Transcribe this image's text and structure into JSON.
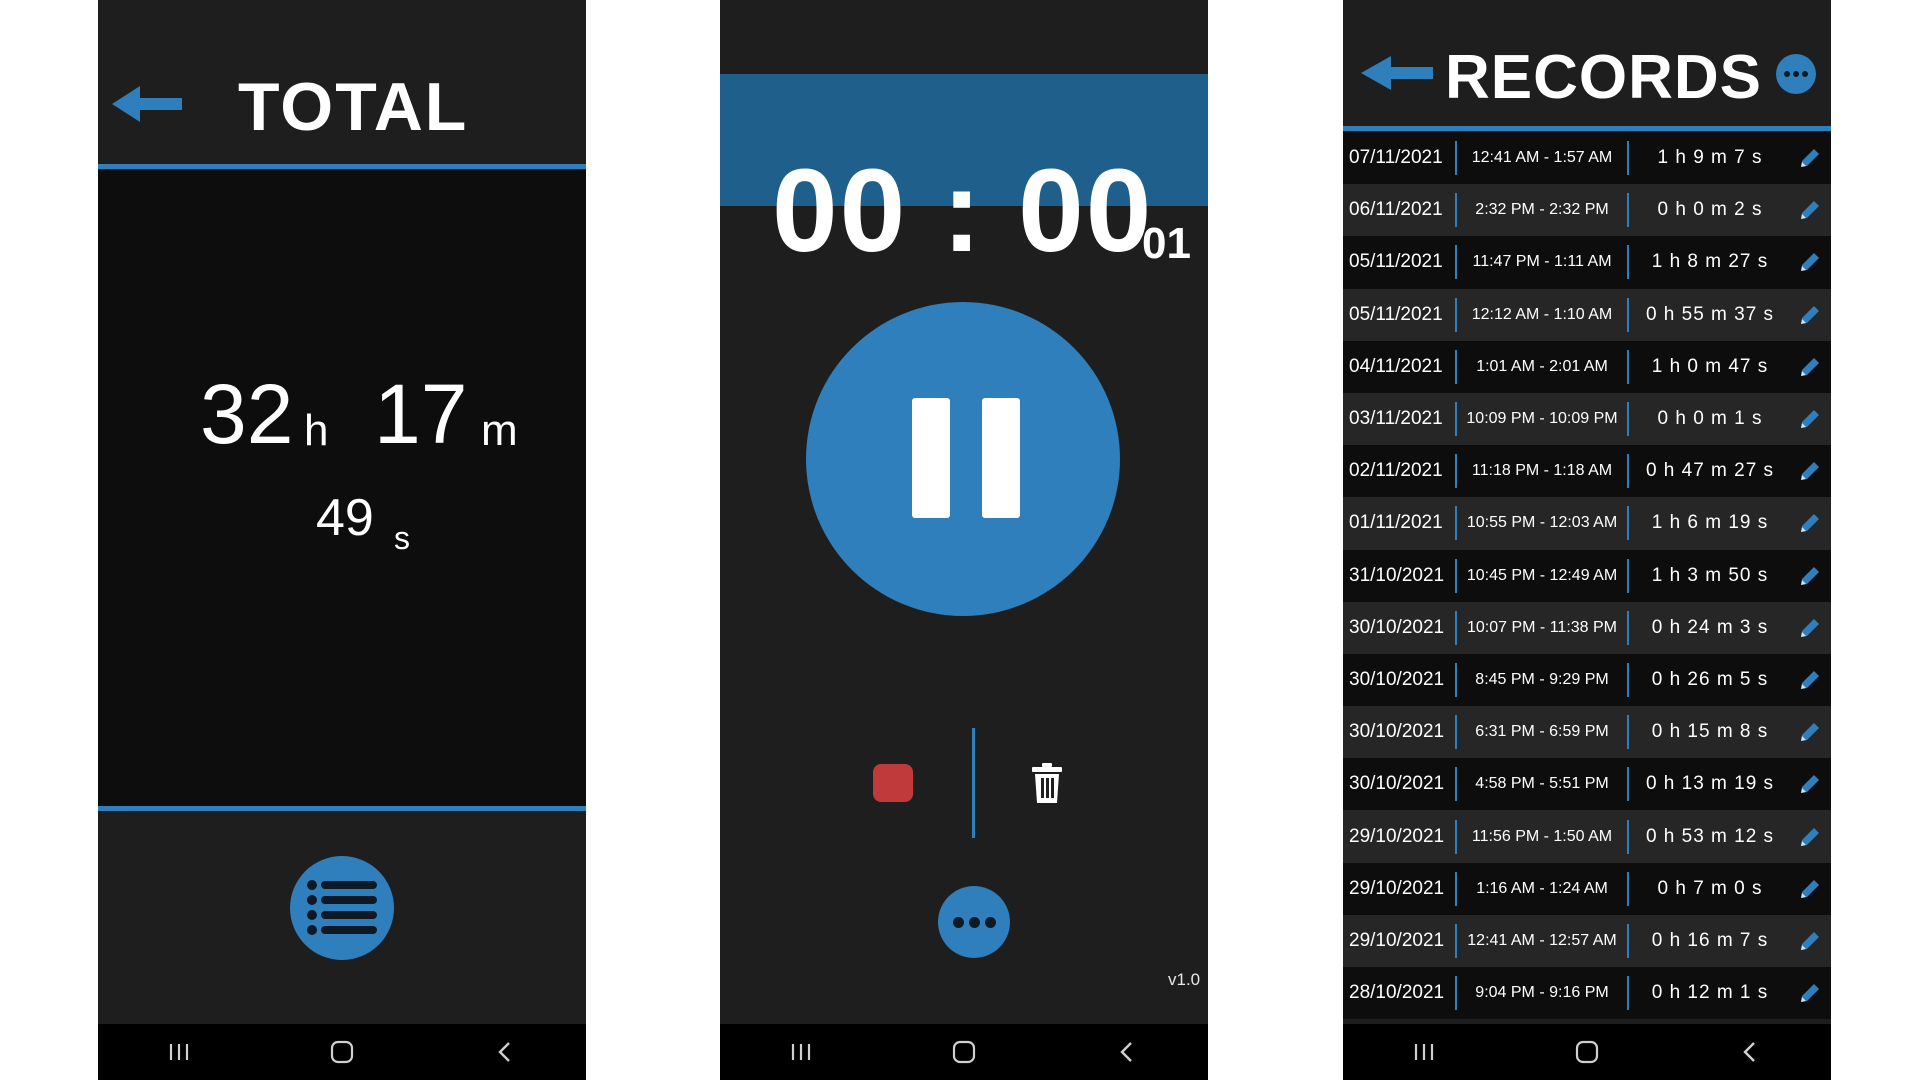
{
  "total_screen": {
    "title": "TOTAL",
    "hours": "32",
    "hours_unit": "h",
    "minutes": "17",
    "minutes_unit": "m",
    "seconds": "49",
    "seconds_unit": "s",
    "icons": {
      "back": "back-arrow-icon",
      "list": "list-icon"
    }
  },
  "timer_screen": {
    "time": "00 : 00",
    "fraction": "01",
    "version": "v1.0",
    "icons": {
      "pause": "pause-icon",
      "stop": "stop-icon",
      "delete": "trash-icon",
      "more": "more-icon"
    }
  },
  "records_screen": {
    "title": "RECORDS",
    "icons": {
      "back": "back-arrow-icon",
      "more": "more-icon",
      "edit": "pencil-icon"
    },
    "records": [
      {
        "date": "07/11/2021",
        "time": "12:41 AM - 1:57 AM",
        "duration": "1 h 9 m 7 s"
      },
      {
        "date": "06/11/2021",
        "time": "2:32 PM - 2:32 PM",
        "duration": "0 h 0 m 2 s"
      },
      {
        "date": "05/11/2021",
        "time": "11:47 PM - 1:11 AM",
        "duration": "1 h 8 m 27 s"
      },
      {
        "date": "05/11/2021",
        "time": "12:12 AM - 1:10 AM",
        "duration": "0 h 55 m 37 s"
      },
      {
        "date": "04/11/2021",
        "time": "1:01 AM - 2:01 AM",
        "duration": "1 h 0 m 47 s"
      },
      {
        "date": "03/11/2021",
        "time": "10:09 PM - 10:09 PM",
        "duration": "0 h 0 m 1 s"
      },
      {
        "date": "02/11/2021",
        "time": "11:18 PM - 1:18 AM",
        "duration": "0 h 47 m 27 s"
      },
      {
        "date": "01/11/2021",
        "time": "10:55 PM - 12:03 AM",
        "duration": "1 h 6 m 19 s"
      },
      {
        "date": "31/10/2021",
        "time": "10:45 PM - 12:49 AM",
        "duration": "1 h 3 m 50 s"
      },
      {
        "date": "30/10/2021",
        "time": "10:07 PM - 11:38 PM",
        "duration": "0 h 24 m 3 s"
      },
      {
        "date": "30/10/2021",
        "time": "8:45 PM - 9:29 PM",
        "duration": "0 h 26 m 5 s"
      },
      {
        "date": "30/10/2021",
        "time": "6:31 PM - 6:59 PM",
        "duration": "0 h 15 m 8 s"
      },
      {
        "date": "30/10/2021",
        "time": "4:58 PM - 5:51 PM",
        "duration": "0 h 13 m 19 s"
      },
      {
        "date": "29/10/2021",
        "time": "11:56 PM - 1:50 AM",
        "duration": "0 h 53 m 12 s"
      },
      {
        "date": "29/10/2021",
        "time": "1:16 AM - 1:24 AM",
        "duration": "0 h 7 m 0 s"
      },
      {
        "date": "29/10/2021",
        "time": "12:41 AM - 12:57 AM",
        "duration": "0 h 16 m 7 s"
      },
      {
        "date": "28/10/2021",
        "time": "9:04 PM - 9:16 PM",
        "duration": "0 h 12 m 1 s"
      }
    ]
  },
  "nav_bar": {
    "icons": [
      "recent-apps-icon",
      "home-icon",
      "back-icon"
    ]
  },
  "colors": {
    "accent": "#2e7fbb",
    "timer_band": "#1f5f8b",
    "stop": "#c0393b",
    "background": "#1e1e1e",
    "panel": "#0d0d0d"
  }
}
